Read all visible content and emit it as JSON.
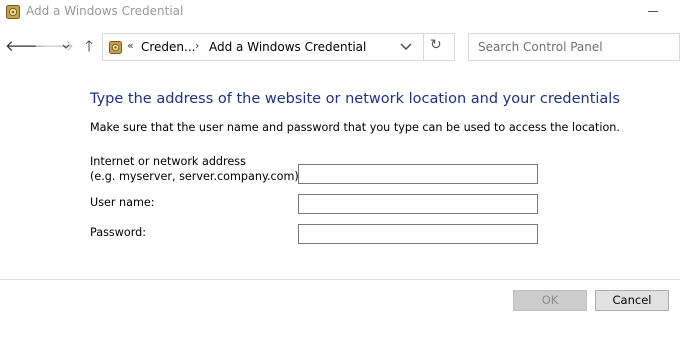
{
  "window": {
    "title": "Add a Windows Credential"
  },
  "nav": {
    "back_icon": "arrow-left-icon",
    "forward_icon": "arrow-right-icon",
    "recent_icon": "chevron-down-icon",
    "up_icon": "arrow-up-icon"
  },
  "address": {
    "overflow": "«",
    "crumb1": "Creden...",
    "separator": "›",
    "crumb2": "Add a Windows Credential",
    "refresh_glyph": "↻"
  },
  "search": {
    "placeholder": "Search Control Panel"
  },
  "content": {
    "heading": "Type the address of the website or network location and your credentials",
    "subtext": "Make sure that the user name and password that you type can be used to access the location.",
    "address_label_line1": "Internet or network address",
    "address_label_line2": "(e.g. myserver, server.company.com):",
    "username_label": "User name:",
    "password_label": "Password:",
    "address_value": "",
    "username_value": "",
    "password_value": ""
  },
  "buttons": {
    "ok": "OK",
    "cancel": "Cancel",
    "ok_enabled": false
  },
  "colors": {
    "heading": "#1e3287",
    "icon_gold": "#c8a24a"
  }
}
